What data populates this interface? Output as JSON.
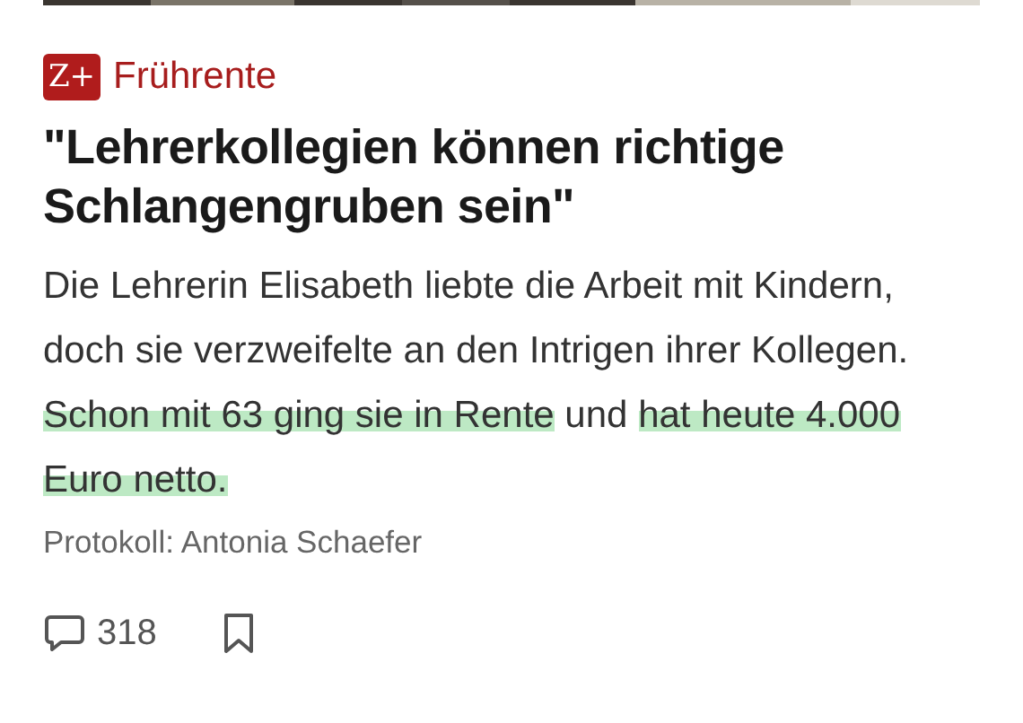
{
  "kicker": {
    "badge": "Z+",
    "label": "Frührente"
  },
  "headline": "\"Lehrerkollegien können richtige Schlangengruben sein\"",
  "teaser": [
    {
      "text": "Die Lehrerin Elisabeth liebte die Arbeit mit Kindern, doch sie verzweifelte an den Intrigen ihrer Kollegen. ",
      "highlighted": false
    },
    {
      "text": "Schon mit 63 ging sie in Rente",
      "highlighted": true
    },
    {
      "text": " und ",
      "highlighted": false
    },
    {
      "text": "hat heute 4.000 Euro netto.",
      "highlighted": true
    }
  ],
  "byline": "Protokoll: Antonia Schaefer",
  "actions": {
    "comments": "318",
    "bookmarked": false
  }
}
